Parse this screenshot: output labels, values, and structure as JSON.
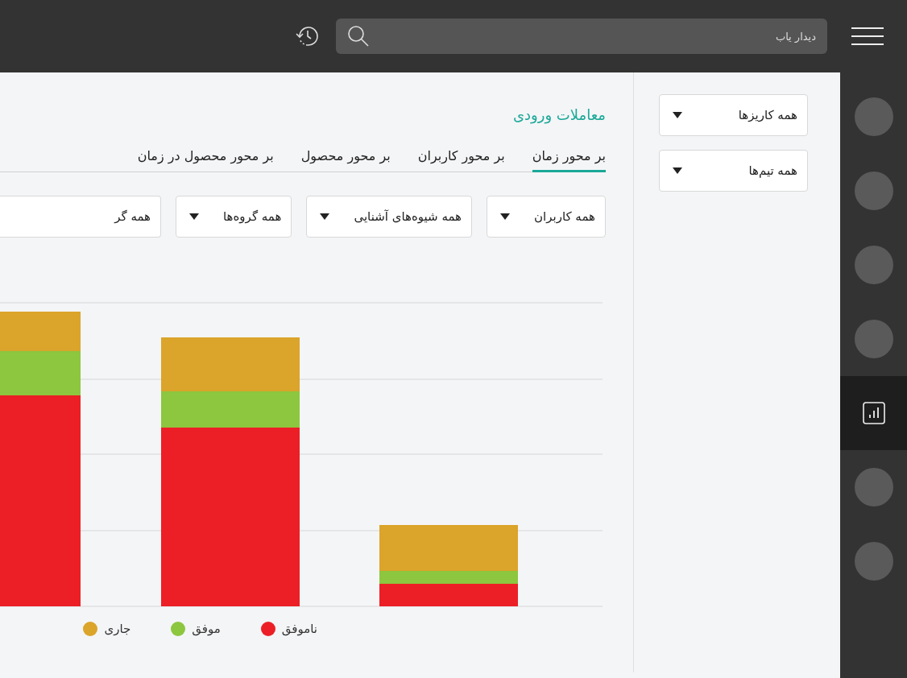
{
  "search": {
    "placeholder": "دیدار یاب"
  },
  "rail": [
    {
      "kind": "placeholder",
      "selected": false
    },
    {
      "kind": "placeholder",
      "selected": false
    },
    {
      "kind": "placeholder",
      "selected": false
    },
    {
      "kind": "placeholder",
      "selected": false
    },
    {
      "kind": "chart",
      "selected": true
    },
    {
      "kind": "placeholder",
      "selected": false
    },
    {
      "kind": "placeholder",
      "selected": false
    }
  ],
  "sidebar": {
    "filters": [
      "همه کاریزها",
      "همه تیم‌ها"
    ]
  },
  "main": {
    "title": "معاملات ورودی",
    "tabs": [
      {
        "label": "بر محور زمان",
        "selected": true
      },
      {
        "label": "بر محور کاربران",
        "selected": false
      },
      {
        "label": "بر محور محصول",
        "selected": false
      },
      {
        "label": "بر محور محصول در زمان",
        "selected": false
      }
    ],
    "filters": [
      "همه کاربران",
      "همه شیوه‌های آشنایی",
      "همه گروه‌ها",
      "همه گر"
    ],
    "legend": [
      {
        "label": "ناموفق",
        "color": "#ec1f26"
      },
      {
        "label": "موفق",
        "color": "#8dc63f"
      },
      {
        "label": "جاری",
        "color": "#dba42a"
      }
    ]
  }
}
